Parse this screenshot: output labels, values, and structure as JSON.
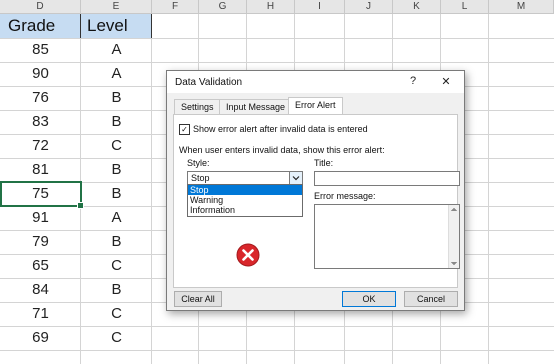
{
  "sheet": {
    "columns": [
      "D",
      "E",
      "F",
      "G",
      "H",
      "I",
      "J",
      "K",
      "L",
      "M"
    ],
    "header": {
      "grade": "Grade",
      "level": "Level"
    },
    "rows": [
      {
        "grade": "85",
        "level": "A"
      },
      {
        "grade": "90",
        "level": "A"
      },
      {
        "grade": "76",
        "level": "B"
      },
      {
        "grade": "83",
        "level": "B"
      },
      {
        "grade": "72",
        "level": "C"
      },
      {
        "grade": "81",
        "level": "B"
      },
      {
        "grade": "75",
        "level": "B"
      },
      {
        "grade": "91",
        "level": "A"
      },
      {
        "grade": "79",
        "level": "B"
      },
      {
        "grade": "65",
        "level": "C"
      },
      {
        "grade": "84",
        "level": "B"
      },
      {
        "grade": "71",
        "level": "C"
      },
      {
        "grade": "69",
        "level": "C"
      }
    ]
  },
  "dialog": {
    "title": "Data Validation",
    "help": "?",
    "close": "✕",
    "tabs": [
      "Settings",
      "Input Message",
      "Error Alert"
    ],
    "active_tab": "Error Alert",
    "show_alert_label": "Show error alert after invalid data is entered",
    "show_alert_checked": true,
    "instruction": "When user enters invalid data, show this error alert:",
    "style_label": "Style:",
    "style_value": "Stop",
    "style_options": [
      "Stop",
      "Warning",
      "Information"
    ],
    "title_label": "Title:",
    "title_value": "",
    "message_label": "Error message:",
    "message_value": "",
    "icon": "stop-error-icon",
    "buttons": {
      "clear_all": "Clear All",
      "ok": "OK",
      "cancel": "Cancel"
    },
    "colors": {
      "selection": "#217346",
      "highlight": "#0078d7",
      "error_icon": "#d9262b"
    }
  }
}
